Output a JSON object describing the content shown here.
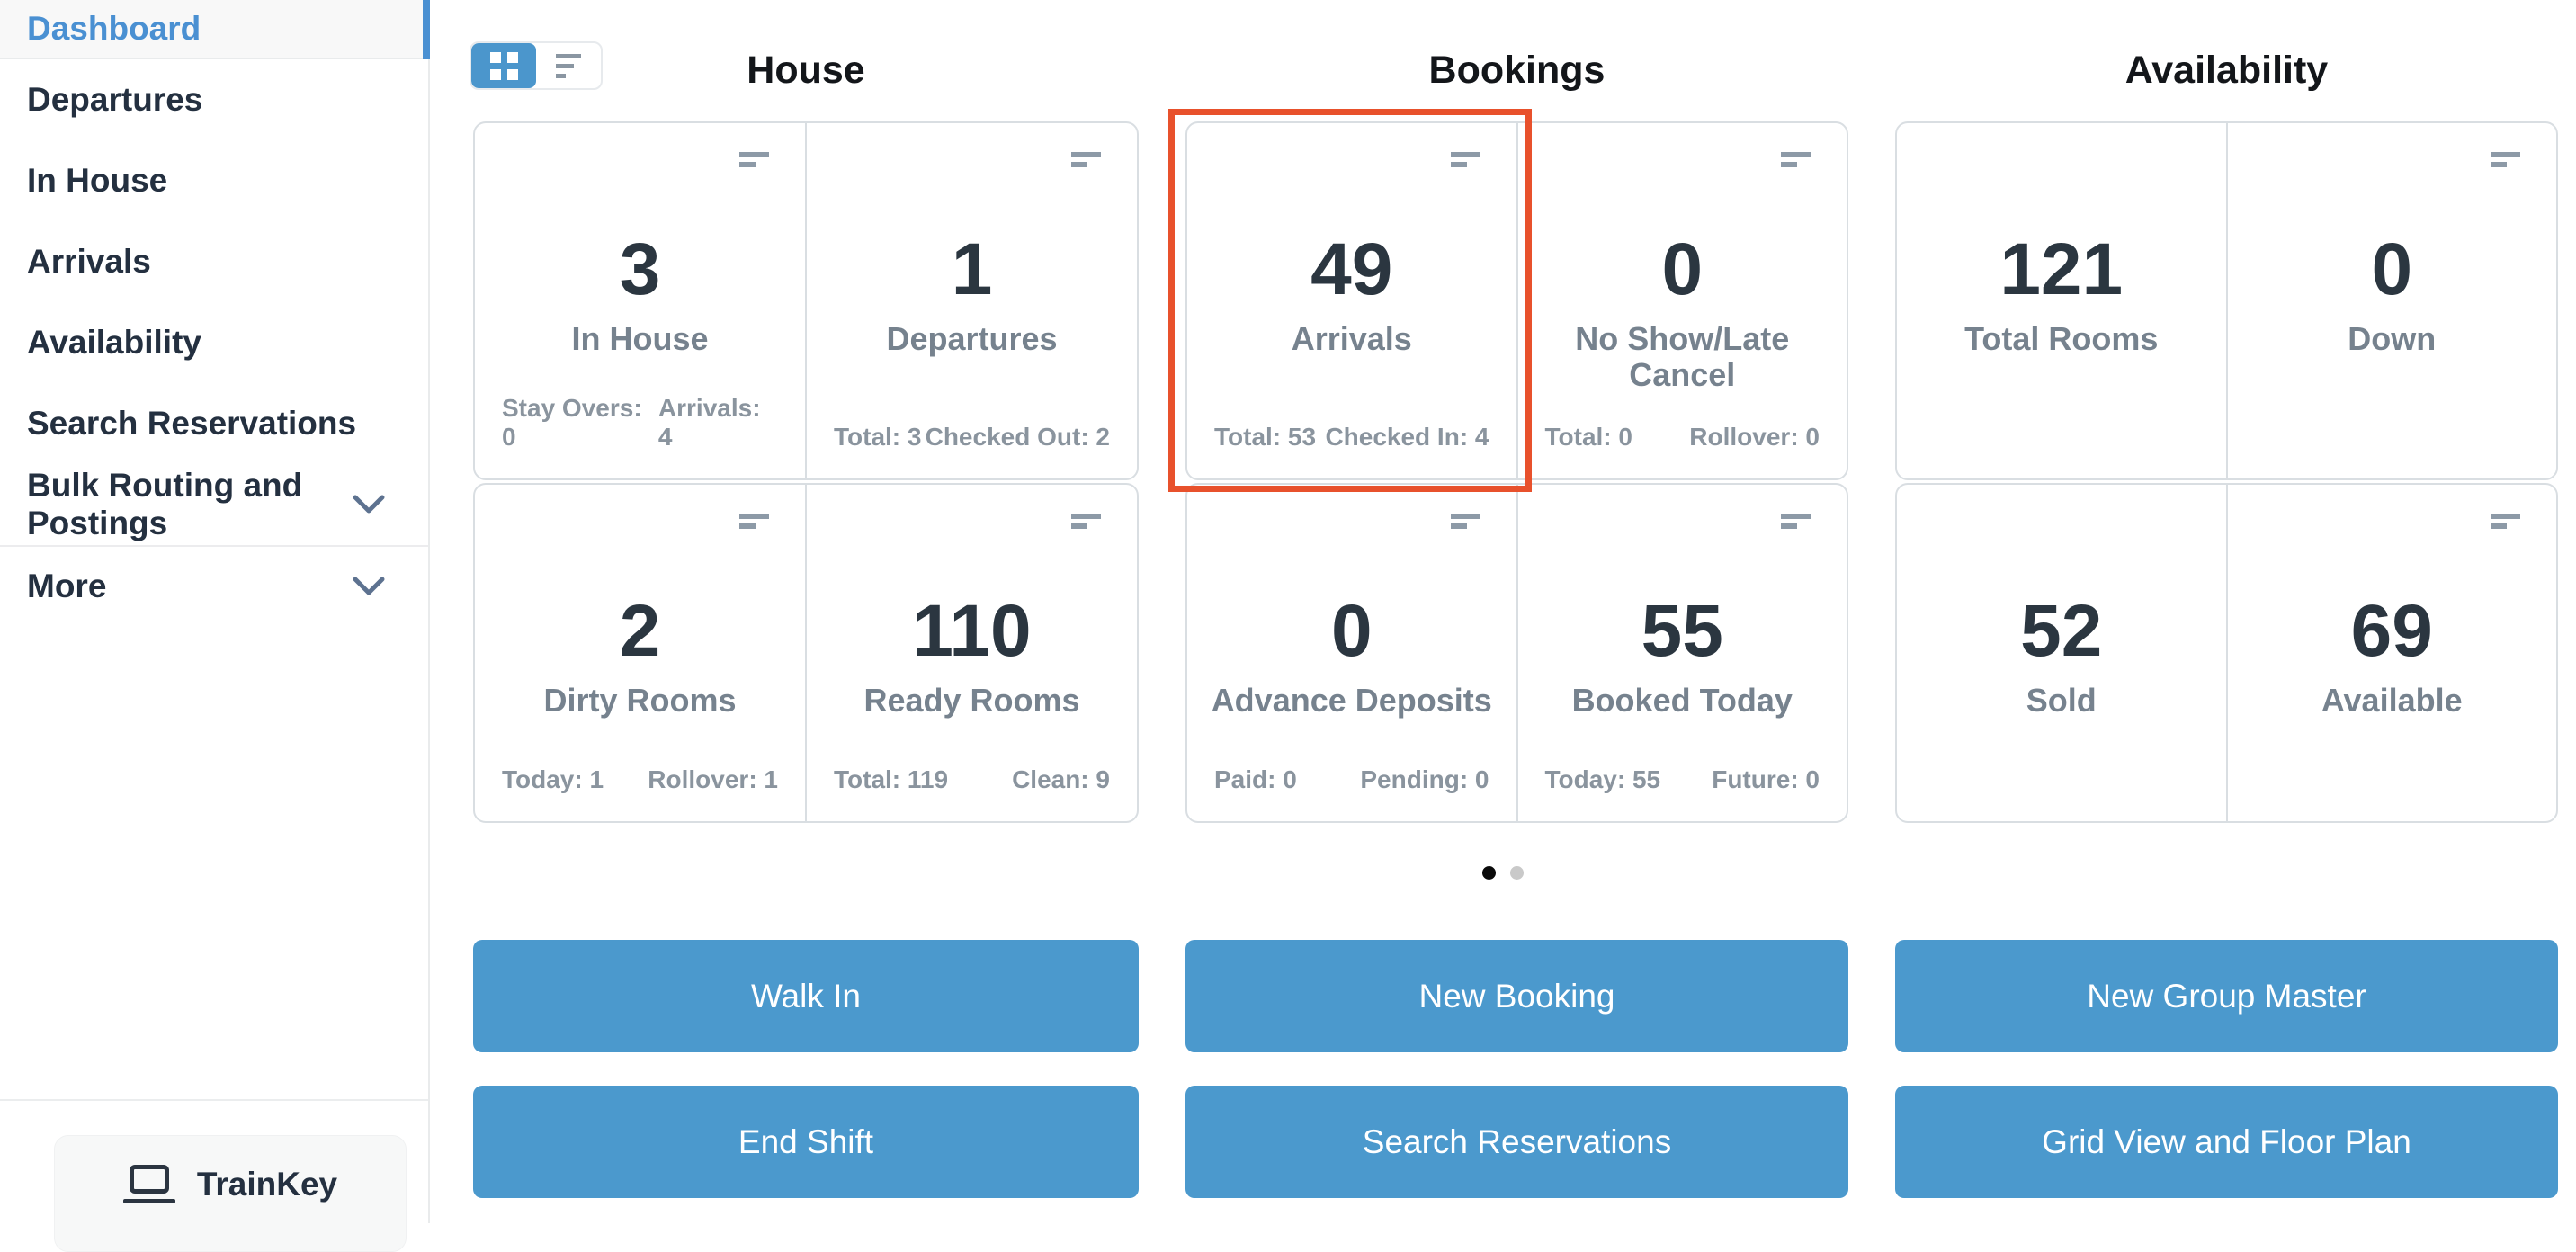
{
  "sidebar": {
    "items": [
      {
        "label": "Dashboard"
      },
      {
        "label": "Departures"
      },
      {
        "label": "In House"
      },
      {
        "label": "Arrivals"
      },
      {
        "label": "Availability"
      },
      {
        "label": "Search Reservations"
      },
      {
        "label": "Bulk Routing and Postings"
      },
      {
        "label": "More"
      }
    ],
    "brand": "TrainKey"
  },
  "headers": {
    "house": "House",
    "bookings": "Bookings",
    "availability": "Availability"
  },
  "cards": {
    "house": [
      {
        "value": "3",
        "label": "In House",
        "stat_left": "Stay Overs: 0",
        "stat_right": "Arrivals: 4"
      },
      {
        "value": "1",
        "label": "Departures",
        "stat_left": "Total: 3",
        "stat_right": "Checked Out: 2"
      },
      {
        "value": "2",
        "label": "Dirty Rooms",
        "stat_left": "Today: 1",
        "stat_right": "Rollover: 1"
      },
      {
        "value": "110",
        "label": "Ready Rooms",
        "stat_left": "Total: 119",
        "stat_right": "Clean: 9"
      }
    ],
    "bookings": [
      {
        "value": "49",
        "label": "Arrivals",
        "stat_left": "Total: 53",
        "stat_right": "Checked In: 4"
      },
      {
        "value": "0",
        "label": "No Show/Late Cancel",
        "stat_left": "Total: 0",
        "stat_right": "Rollover: 0"
      },
      {
        "value": "0",
        "label": "Advance Deposits",
        "stat_left": "Paid: 0",
        "stat_right": "Pending: 0"
      },
      {
        "value": "55",
        "label": "Booked Today",
        "stat_left": "Today: 55",
        "stat_right": "Future: 0"
      }
    ],
    "availability": [
      {
        "value": "121",
        "label": "Total Rooms"
      },
      {
        "value": "0",
        "label": "Down"
      },
      {
        "value": "52",
        "label": "Sold"
      },
      {
        "value": "69",
        "label": "Available"
      }
    ]
  },
  "actions": {
    "walk_in": "Walk In",
    "new_booking": "New Booking",
    "new_group_master": "New Group Master",
    "end_shift": "End Shift",
    "search_reservations": "Search Reservations",
    "grid_view_floor_plan": "Grid View and Floor Plan"
  },
  "colors": {
    "accent_blue": "#4B99CD",
    "active_link_blue": "#4A90D2",
    "highlight_red": "#E8512C"
  }
}
